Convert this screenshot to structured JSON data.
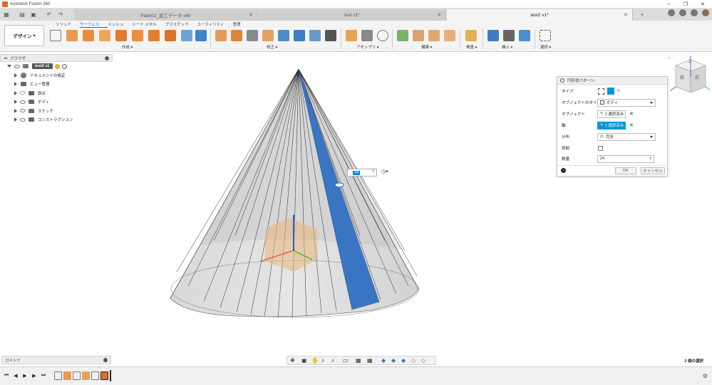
{
  "window": {
    "title": "Autodesk Fusion 360"
  },
  "tabs": [
    {
      "label": "Plate02_加工データ v60"
    },
    {
      "label": "test v1*"
    },
    {
      "label": "test2 v1*"
    }
  ],
  "ribbon": {
    "design_label": "デザイン",
    "tabs": [
      "ソリッド",
      "サーフェス",
      "メッシュ",
      "シート メタル",
      "プラスチック",
      "ユーティリティ",
      "管理"
    ],
    "groups": [
      "作成",
      "修正",
      "アセンブリ",
      "構築",
      "検査",
      "挿入",
      "選択"
    ]
  },
  "browser": {
    "title": "ブラウザ",
    "root": "test2 v1",
    "items": [
      "ドキュメントの設定",
      "ビュー管理",
      "原点",
      "ボディ",
      "スケッチ",
      "コンストラクション"
    ]
  },
  "dialog": {
    "title": "円形状パターン",
    "type_label": "タイプ",
    "type_value_text": "ボディ",
    "object_type_label": "オブジェクトのタイプ",
    "object_type_value": "ボディ",
    "objects_label": "オブジェクト",
    "objects_value": "1 選択済み",
    "axis_label": "軸",
    "axis_value": "1 選択済み",
    "distribution_label": "分布",
    "distribution_value": "完全",
    "suppress_label": "抑制",
    "quantity_label": "数量",
    "quantity_value": "24",
    "ok_label": "OK",
    "cancel_label": "キャンセル"
  },
  "inline_quantity": "24",
  "comments_label": "コメント",
  "status_text": "2 個の選択",
  "viewcube": {
    "top": "上",
    "front": "前",
    "right": "右"
  },
  "colors": {
    "accent": "#0a7bd6",
    "selected_face": "#3a75c4",
    "sketch_plane": "#e8b47a"
  }
}
